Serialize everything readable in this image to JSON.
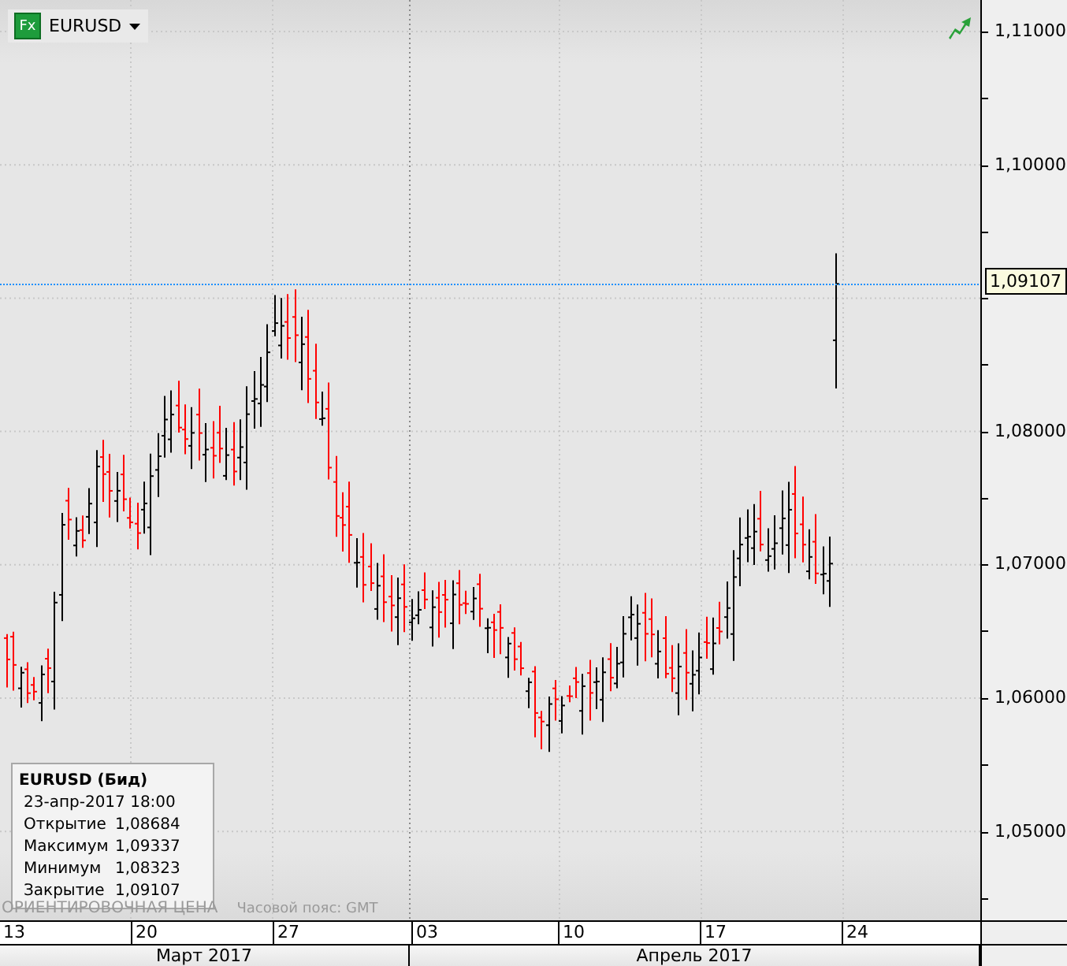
{
  "symbol_selector": {
    "badge": "Fx",
    "label": "EURUSD"
  },
  "y_axis": {
    "labels": [
      "1,11000",
      "1,10000",
      "1,08000",
      "1,07000",
      "1,06000",
      "1,05000"
    ],
    "price_tag": "1,09107"
  },
  "legend": {
    "title": "EURUSD (Бид)",
    "date": "23-апр-2017 18:00",
    "rows": [
      {
        "label": "Открытие",
        "value": "1,08684"
      },
      {
        "label": "Максимум",
        "value": "1,09337"
      },
      {
        "label": "Минимум",
        "value": "1,08323"
      },
      {
        "label": "Закрытие",
        "value": "1,09107"
      }
    ]
  },
  "footer": {
    "price_note": "ОРИЕНТИРОВОЧНАЯ ЦЕНА",
    "timezone": "Часовой пояс: GMT"
  },
  "x_axis": {
    "days": [
      "13",
      "20",
      "27",
      "03",
      "10",
      "17",
      "24"
    ],
    "months": [
      "Март 2017",
      "Апрель 2017"
    ]
  }
}
